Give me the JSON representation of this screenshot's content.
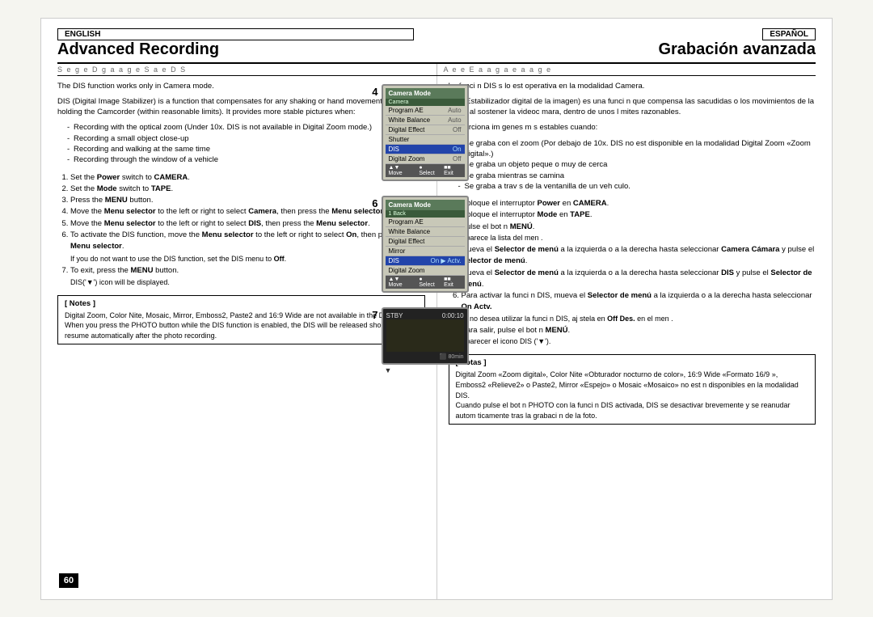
{
  "page": {
    "background": "#f5f5f0"
  },
  "left": {
    "lang_badge": "ENGLISH",
    "section_title": "Advanced Recording",
    "subtitle": "S e  g  e  D  g  a     a g e  S  a     e    D  S",
    "intro": [
      "The DIS function works only in Camera mode.",
      "DIS (Digital Image Stabilizer) is a function that compensates for any shaking or hand movement while holding the Camcorder (within reasonable limits). It provides more stable pictures when:"
    ],
    "bullets": [
      "Recording with the optical zoom (Under 10x. DIS is not available in Digital Zoom mode.)",
      "Recording a small object close-up",
      "Recording and walking at the same time",
      "Recording through the window of a vehicle"
    ],
    "steps": [
      {
        "num": "1.",
        "text": "Set the ",
        "bold": "Power",
        "text2": " switch to ",
        "bold2": "CAMERA",
        "text3": "."
      },
      {
        "num": "2.",
        "text": "Set the ",
        "bold": "Mode",
        "text2": " switch to ",
        "bold2": "TAPE",
        "text3": "."
      },
      {
        "num": "3.",
        "text": "Press the ",
        "bold": "MENU",
        "text2": " button.",
        "bold2": "",
        "text3": ""
      },
      {
        "num": "4.",
        "text": "Move the ",
        "bold": "Menu selector",
        "text2": " to the left or right to select ",
        "bold2": "Camera",
        "text3": ", then press the ",
        "bold3": "Menu selector",
        "text4": "."
      },
      {
        "num": "5.",
        "text": "Move the ",
        "bold": "Menu selector",
        "text2": " to the left or right to select ",
        "bold2": "DIS",
        "text3": ", then press the ",
        "bold3": "Menu selector",
        "text4": "."
      },
      {
        "num": "6.",
        "text": "To activate the DIS function, move the ",
        "bold": "Menu selector",
        "text2": " to the left or right to select ",
        "bold2": "On",
        "text3": ", then press the ",
        "bold3": "Menu selector",
        "text4": "."
      },
      {
        "num": "",
        "sub": "If you do not want to use the DIS function, set the DIS menu to Off."
      },
      {
        "num": "7.",
        "text": "To exit, press the ",
        "bold": "MENU",
        "text2": " button.",
        "bold2": "",
        "text3": ""
      },
      {
        "num": "",
        "sub": "DIS('▼') icon will be displayed."
      }
    ],
    "notes_title": "[ Notes ]",
    "notes": "Digital Zoom, Color Nite, Mosaic, Mirror, Emboss2, Paste2 and 16:9 Wide are not available in the DIS mode.\nWhen you press the PHOTO button while the DIS function is enabled, the DIS will be released shortly and resume automatically after the photo recording."
  },
  "right": {
    "lang_badge": "ESPAÑOL",
    "section_title": "Grabación avanzada",
    "subtitle": "A  e  e  E  a     a  g  a  e  a     a g e",
    "intro": [
      "La funci n DIS s lo est  operativa en la modalidad Camera.",
      "DIS (Estabilizador digital de la imagen) es una funci n que compensa las sacudidas o los movimientos de la mano al sostener la videoc mara, dentro de unos l mites razonables.",
      "Proporciona im genes m s estables cuando:"
    ],
    "bullets": [
      "Se graba con el zoom (Por debajo de 10x. DIS no est  disponible en la modalidad Digital Zoom «Zoom digital».)",
      "Se graba un objeto peque o muy de cerca",
      "Se graba mientras se camina",
      "Se graba a trav s de la ventanilla de un veh culo."
    ],
    "steps": [
      {
        "num": "1.",
        "text": "Coloque el interruptor ",
        "bold": "Power",
        "text2": " en ",
        "bold2": "CAMERA",
        "text3": "."
      },
      {
        "num": "2.",
        "text": "Coloque el interruptor ",
        "bold": "Mode",
        "text2": " en ",
        "bold2": "TAPE",
        "text3": "."
      },
      {
        "num": "3.",
        "text": "Pulse el bot n ",
        "bold": "MENÚ",
        "text2": ".",
        "bold2": "",
        "text3": ""
      },
      {
        "num": "",
        "sub": "Aparece la lista del men ."
      },
      {
        "num": "4.",
        "text": "Mueva el ",
        "bold": "Selector de menú",
        "text2": " a la izquierda o a la derecha hasta seleccionar ",
        "bold2": "Camera  Cámara",
        "text3": "  y pulse el ",
        "bold3": "Selector de menú",
        "text4": "."
      },
      {
        "num": "5.",
        "text": "Mueva el ",
        "bold": "Selector de menú",
        "text2": " a la izquierda o a la derecha hasta seleccionar ",
        "bold2": "DIS",
        "text3": "  y pulse el ",
        "bold3": "Selector de menú",
        "text4": "."
      },
      {
        "num": "6.",
        "text": "Para activar la funci n DIS, mueva el ",
        "bold": "Selector de menú",
        "text2": " a la izquierda o a la derecha hasta seleccionar ",
        "bold2": "On  Actv.",
        "text3": ""
      },
      {
        "num": "",
        "sub": "Si no desea utilizar la funci n DIS, aj stela en  Off  Des.  en el men ."
      },
      {
        "num": "7.",
        "text": "Para salir, pulse el bot n ",
        "bold": "MENÚ",
        "text2": ".",
        "bold2": "",
        "text3": ""
      },
      {
        "num": "",
        "sub": "Aparecer  el icono DIS ('▼')."
      }
    ],
    "notes_title": "[ Notas ]",
    "notes": "Digital Zoom «Zoom digital», Color Nite «Obturador nocturno de color», 16:9 Wide «Formato 16/9 », Emboss2 «Relieve2» o Paste2, Mirror «Espejo» o Mosaic «Mosaico» no est n disponibles en la modalidad DIS.\nCuando pulse el bot n PHOTO con la funci n DIS activada, DIS se desactivar  brevemente y se reanudar  autom ticamente tras la grabaci n de la foto."
  },
  "camera_screens": {
    "screen1": {
      "label": "4",
      "header": "Camera Mode",
      "mode": "Camera",
      "rows": [
        {
          "label": "Program AE",
          "value": "Auto"
        },
        {
          "label": "White Balance",
          "value": "Auto"
        },
        {
          "label": "Digital Effect",
          "value": "Off"
        },
        {
          "label": "Shutter",
          "value": ""
        },
        {
          "label": "DIS",
          "value": "On",
          "selected": true
        },
        {
          "label": "Digital Zoom",
          "value": "Off"
        }
      ],
      "nav": "▲▼ Move  ● Select  ■■■ Exit"
    },
    "screen2": {
      "label": "6",
      "header": "Camera Mode",
      "mode": "1 Back",
      "rows": [
        {
          "label": "Program AE",
          "value": ""
        },
        {
          "label": "White Balance",
          "value": ""
        },
        {
          "label": "Digital Effect",
          "value": ""
        },
        {
          "label": "Mirror",
          "value": ""
        },
        {
          "label": "DIS",
          "value": "",
          "selected": true
        },
        {
          "label": "Digital Zoom",
          "value": ""
        }
      ],
      "nav": "▲▼ Move  ● Select  ■■■ Exit"
    },
    "screen3": {
      "label": "7",
      "stby": "STBY",
      "time": "0:00:10",
      "battery": "80min",
      "dis_icon": "▼"
    }
  },
  "page_number": "60"
}
